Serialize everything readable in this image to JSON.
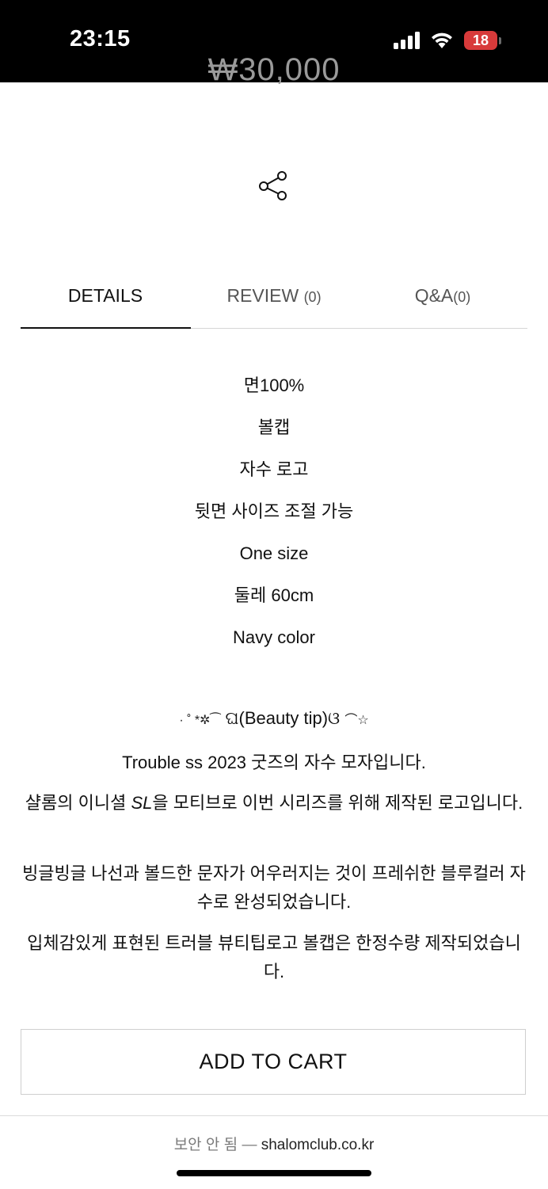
{
  "status_bar": {
    "time": "23:15",
    "battery": "18"
  },
  "product": {
    "price": "₩30,000"
  },
  "tabs": [
    {
      "label": "DETAILS",
      "count": ""
    },
    {
      "label": "REVIEW",
      "count": "(0)"
    },
    {
      "label": "Q&A",
      "count": "(0)"
    }
  ],
  "specs": [
    "면100%",
    "볼캡",
    "자수 로고",
    "뒷면 사이즈 조절 가능",
    "One size",
    "둘레 60cm",
    "Navy color"
  ],
  "beauty_tip": {
    "prefix": "· ˚ *✲⁀",
    "title": "ଘ(Beauty tip)ଓ",
    "suffix": "⌒☆"
  },
  "description": {
    "p1": "Trouble ss 2023  굿즈의 자수 모자입니다.",
    "p2_before": "샬롬의 이니셜 ",
    "p2_italic": "SL",
    "p2_after": "을 모티브로 이번 시리즈를 위해 제작된 로고입니다.",
    "p3": "빙글빙글 나선과 볼드한 문자가 어우러지는 것이 프레쉬한 블루컬러 자수로 완성되었습니다.",
    "p4": "입체감있게 표현된 트러블 뷰티팁로고 볼캡은 한정수량 제작되었습니다."
  },
  "cart": {
    "button_label": "ADD TO CART"
  },
  "browser": {
    "insecure_label": "보안 안 됨 —",
    "domain": "shalomclub.co.kr"
  }
}
